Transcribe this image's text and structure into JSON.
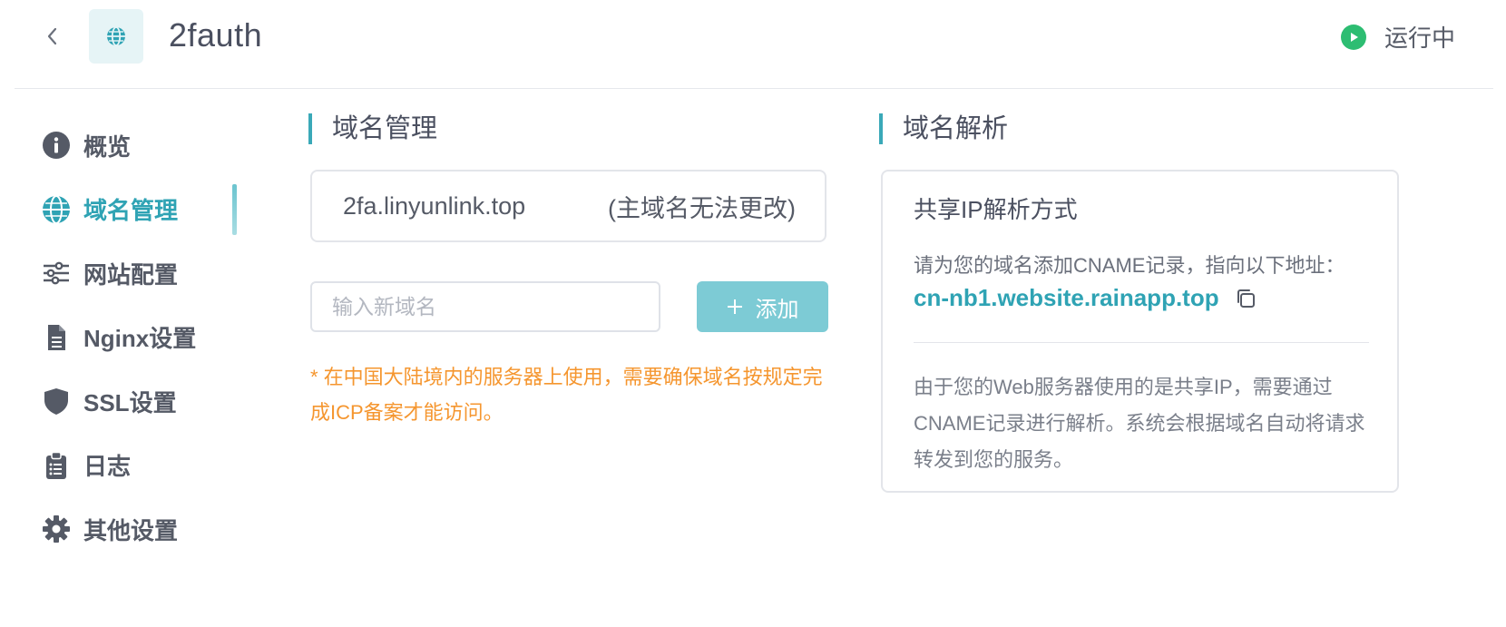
{
  "header": {
    "back_icon": "chevron-left-icon",
    "app_icon": "globe-icon",
    "title": "2fauth",
    "status_icon": "play-circle-icon",
    "status_color": "#2dbd72",
    "status_text": "运行中"
  },
  "sidebar": {
    "items": [
      {
        "label": "概览",
        "icon": "info-icon",
        "active": false
      },
      {
        "label": "域名管理",
        "icon": "globe-icon",
        "active": true
      },
      {
        "label": "网站配置",
        "icon": "sliders-icon",
        "active": false
      },
      {
        "label": "Nginx设置",
        "icon": "file-icon",
        "active": false
      },
      {
        "label": "SSL设置",
        "icon": "shield-icon",
        "active": false
      },
      {
        "label": "日志",
        "icon": "clipboard-icon",
        "active": false
      },
      {
        "label": "其他设置",
        "icon": "gear-icon",
        "active": false
      }
    ]
  },
  "domain_management": {
    "title": "域名管理",
    "primary_domain": "2fa.linyunlink.top",
    "primary_note": "(主域名无法更改)",
    "input_placeholder": "输入新域名",
    "add_button_label": "添加",
    "warning": "* 在中国大陆境内的服务器上使用，需要确保域名按规定完成ICP备案才能访问。"
  },
  "dns": {
    "title": "域名解析",
    "card_title": "共享IP解析方式",
    "instruction": "请为您的域名添加CNAME记录，指向以下地址：",
    "cname_target": "cn-nb1.website.rainapp.top",
    "description": "由于您的Web服务器使用的是共享IP，需要通过CNAME记录进行解析。系统会根据域名自动将请求转发到您的服务。"
  },
  "colors": {
    "accent": "#2fa3b4",
    "warning": "#f5962f",
    "button": "#7dcbd5"
  }
}
